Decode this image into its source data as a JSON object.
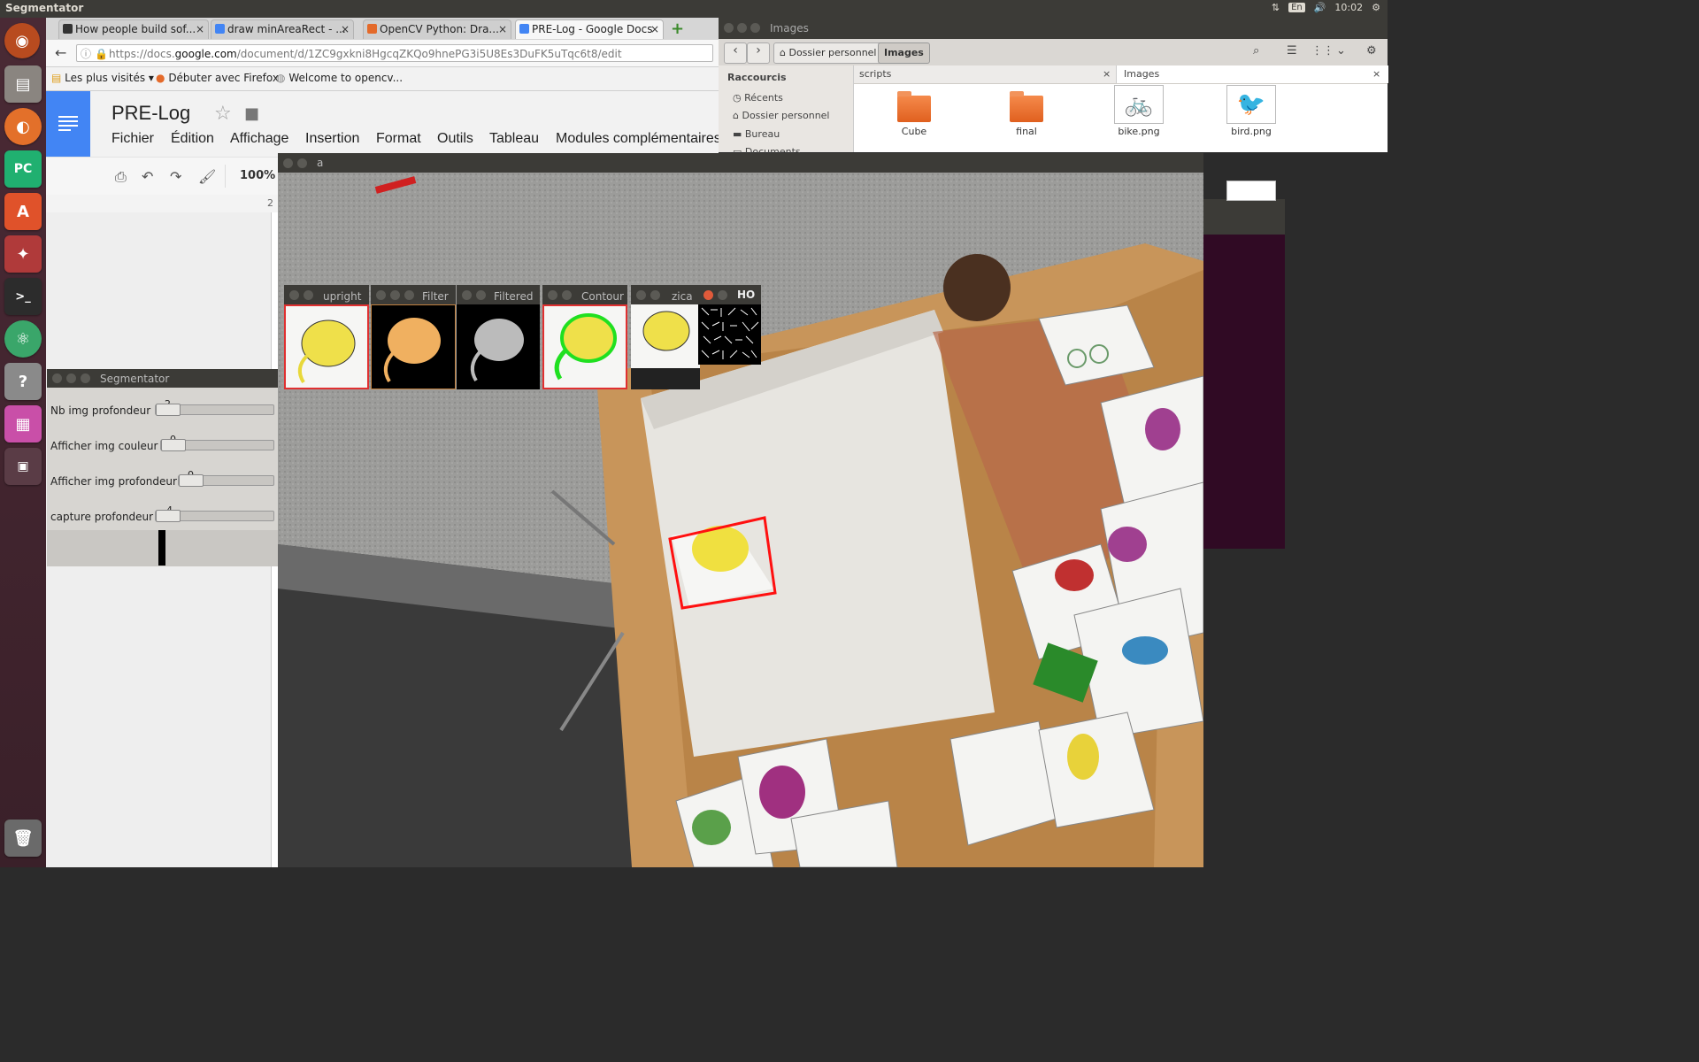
{
  "top_panel": {
    "title": "Segmentator",
    "lang": "En",
    "time": "10:02"
  },
  "launcher": {
    "items": [
      "ubuntu-dash",
      "files",
      "firefox",
      "pycharm",
      "software-center",
      "system-settings",
      "terminal",
      "atom",
      "help",
      "workspace-switcher",
      "window-list",
      "trash"
    ],
    "accent": "#4a2a35"
  },
  "browser": {
    "tabs": [
      {
        "label": "How people build sof...",
        "icon": "github-icon",
        "close": "×"
      },
      {
        "label": "draw minAreaRect - ...",
        "icon": "google-icon",
        "close": "×"
      },
      {
        "label": "OpenCV Python: Dra...",
        "icon": "opencv-icon",
        "close": "×"
      },
      {
        "label": "PRE-Log - Google Docs",
        "icon": "gdocs-icon",
        "close": "×"
      }
    ],
    "new_tab": "+",
    "url_prefix": "https://docs.",
    "url_domain": "google.com",
    "url_path": "/document/d/1ZC9gxkni8HgcqZKQo9hnePG3i5U8Es3DuFK5uTqc6t8/edit",
    "bookmarks": [
      "Les plus visités ▾",
      "Débuter avec Firefox",
      "Welcome to opencv..."
    ],
    "doc_title": "PRE-Log",
    "menu": [
      "Fichier",
      "Édition",
      "Affichage",
      "Insertion",
      "Format",
      "Outils",
      "Tableau",
      "Modules complémentaires"
    ],
    "zoom": "100%",
    "ruler_num": "2",
    "docs_color": "#4285f4"
  },
  "files": {
    "title": "Images",
    "crumbs": [
      "Dossier personnel",
      "Images"
    ],
    "sidebar_heading": "Raccourcis",
    "sidebar_items": [
      "Récents",
      "Dossier personnel",
      "Bureau",
      "Documents"
    ],
    "tabs": [
      "scripts",
      "Images"
    ],
    "tab_close": "×",
    "items": [
      {
        "label": "Cube",
        "kind": "folder"
      },
      {
        "label": "final",
        "kind": "folder"
      },
      {
        "label": "bike.png",
        "kind": "image"
      },
      {
        "label": "bird.png",
        "kind": "image"
      }
    ],
    "folder_color": "#e8692a"
  },
  "camera": {
    "title": "a"
  },
  "segmentator": {
    "title": "Segmentator",
    "sliders": [
      {
        "label": "Nb img profondeur",
        "value": "2"
      },
      {
        "label": "Afficher img couleur",
        "value": "0"
      },
      {
        "label": "Afficher img profondeur",
        "value": "0"
      },
      {
        "label": "capture profondeur",
        "value": "4"
      }
    ]
  },
  "cv_windows": [
    "upright",
    "Filter",
    "Filtered",
    "Contour",
    "zica",
    "HO"
  ]
}
